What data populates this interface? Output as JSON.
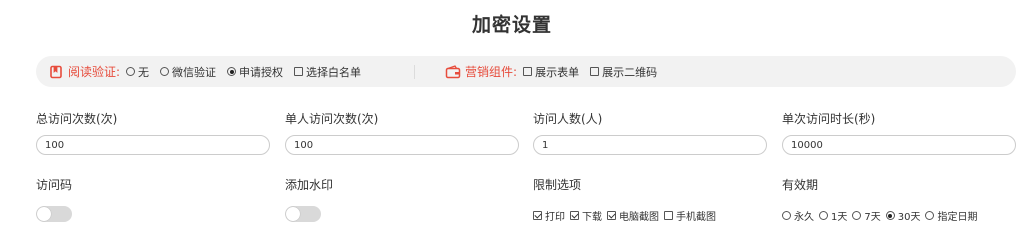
{
  "page": {
    "title": "加密设置"
  },
  "read_verify": {
    "label": "阅读验证:",
    "icon": "bookmark-icon",
    "options": [
      {
        "label": "无",
        "type": "radio",
        "checked": false
      },
      {
        "label": "微信验证",
        "type": "radio",
        "checked": false
      },
      {
        "label": "申请授权",
        "type": "radio",
        "checked": true
      },
      {
        "label": "选择白名单",
        "type": "checkbox",
        "checked": false
      }
    ]
  },
  "marketing": {
    "label": "营销组件:",
    "icon": "wallet-icon",
    "options": [
      {
        "label": "展示表单",
        "type": "checkbox",
        "checked": false
      },
      {
        "label": "展示二维码",
        "type": "checkbox",
        "checked": false
      }
    ]
  },
  "fields": {
    "total_visits": {
      "label": "总访问次数(次)",
      "value": "100"
    },
    "single_visits": {
      "label": "单人访问次数(次)",
      "value": "100"
    },
    "visitors": {
      "label": "访问人数(人)",
      "value": "1"
    },
    "duration": {
      "label": "单次访问时长(秒)",
      "value": "10000"
    }
  },
  "access_code": {
    "label": "访问码",
    "enabled": false
  },
  "watermark": {
    "label": "添加水印",
    "enabled": false
  },
  "restrictions": {
    "label": "限制选项",
    "options": [
      {
        "label": "打印",
        "checked": true
      },
      {
        "label": "下载",
        "checked": true
      },
      {
        "label": "电脑截图",
        "checked": true
      },
      {
        "label": "手机截图",
        "checked": false
      }
    ]
  },
  "validity": {
    "label": "有效期",
    "options": [
      {
        "label": "永久",
        "checked": false
      },
      {
        "label": "1天",
        "checked": false
      },
      {
        "label": "7天",
        "checked": false
      },
      {
        "label": "30天",
        "checked": true
      },
      {
        "label": "指定日期",
        "checked": false
      }
    ]
  },
  "colors": {
    "accent": "#e74c3c",
    "bar_bg": "#f2f2f2",
    "toggle_off": "#d9d9d9"
  }
}
